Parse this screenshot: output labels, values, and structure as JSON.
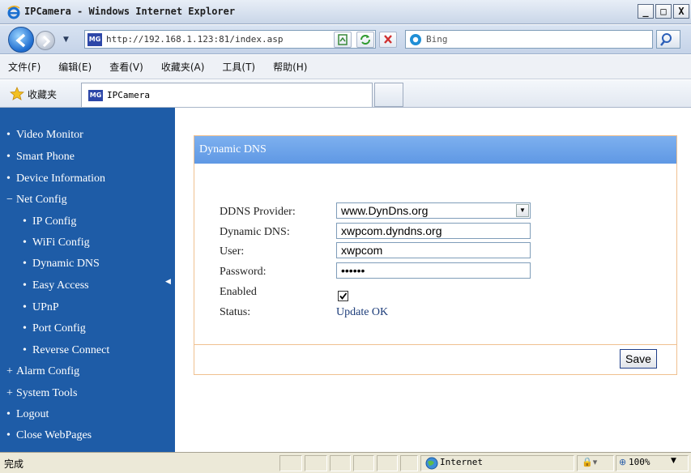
{
  "window": {
    "title": "IPCamera - Windows Internet Explorer",
    "controls": [
      "_",
      "□",
      "X"
    ]
  },
  "address_bar": {
    "url": "http://192.168.1.123:81/index.asp",
    "favicon_text": "MG"
  },
  "search": {
    "placeholder": "Bing"
  },
  "menu": {
    "items": [
      "文件(F)",
      "编辑(E)",
      "查看(V)",
      "收藏夹(A)",
      "工具(T)",
      "帮助(H)"
    ]
  },
  "favorites": {
    "label": "收藏夹",
    "tab_title": "IPCamera",
    "favicon_text": "MG"
  },
  "sidebar": {
    "items": [
      {
        "label": "Video Monitor",
        "bullet": "•"
      },
      {
        "label": "Smart Phone",
        "bullet": "•"
      },
      {
        "label": "Device Information",
        "bullet": "•"
      },
      {
        "label": "Net Config",
        "bullet": "−"
      },
      {
        "label": "IP Config",
        "bullet": "•"
      },
      {
        "label": "WiFi Config",
        "bullet": "•"
      },
      {
        "label": "Dynamic DNS",
        "bullet": "•"
      },
      {
        "label": "Easy Access",
        "bullet": "•"
      },
      {
        "label": "UPnP",
        "bullet": "•"
      },
      {
        "label": "Port Config",
        "bullet": "•"
      },
      {
        "label": "Reverse Connect",
        "bullet": "•"
      },
      {
        "label": "Alarm Config",
        "bullet": "+"
      },
      {
        "label": "System Tools",
        "bullet": "+"
      },
      {
        "label": "Logout",
        "bullet": "•"
      },
      {
        "label": "Close WebPages",
        "bullet": "•"
      }
    ]
  },
  "panel": {
    "title": "Dynamic DNS",
    "fields": {
      "provider_label": "DDNS Provider:",
      "provider_value": "www.DynDns.org",
      "dns_label": "Dynamic DNS:",
      "dns_value": "xwpcom.dyndns.org",
      "user_label": "User:",
      "user_value": "xwpcom",
      "password_label": "Password:",
      "password_value": "••••••",
      "enabled_label": "Enabled",
      "enabled_checked": true,
      "status_label": "Status:",
      "status_value": "Update OK"
    },
    "save_label": "Save"
  },
  "statusbar": {
    "text": "完成",
    "zone": "Internet",
    "zoom": "100%"
  },
  "colors": {
    "sidebar_bg": "#1e5ca7",
    "panel_header": "#6ea4ea",
    "panel_border": "#f0c090"
  }
}
